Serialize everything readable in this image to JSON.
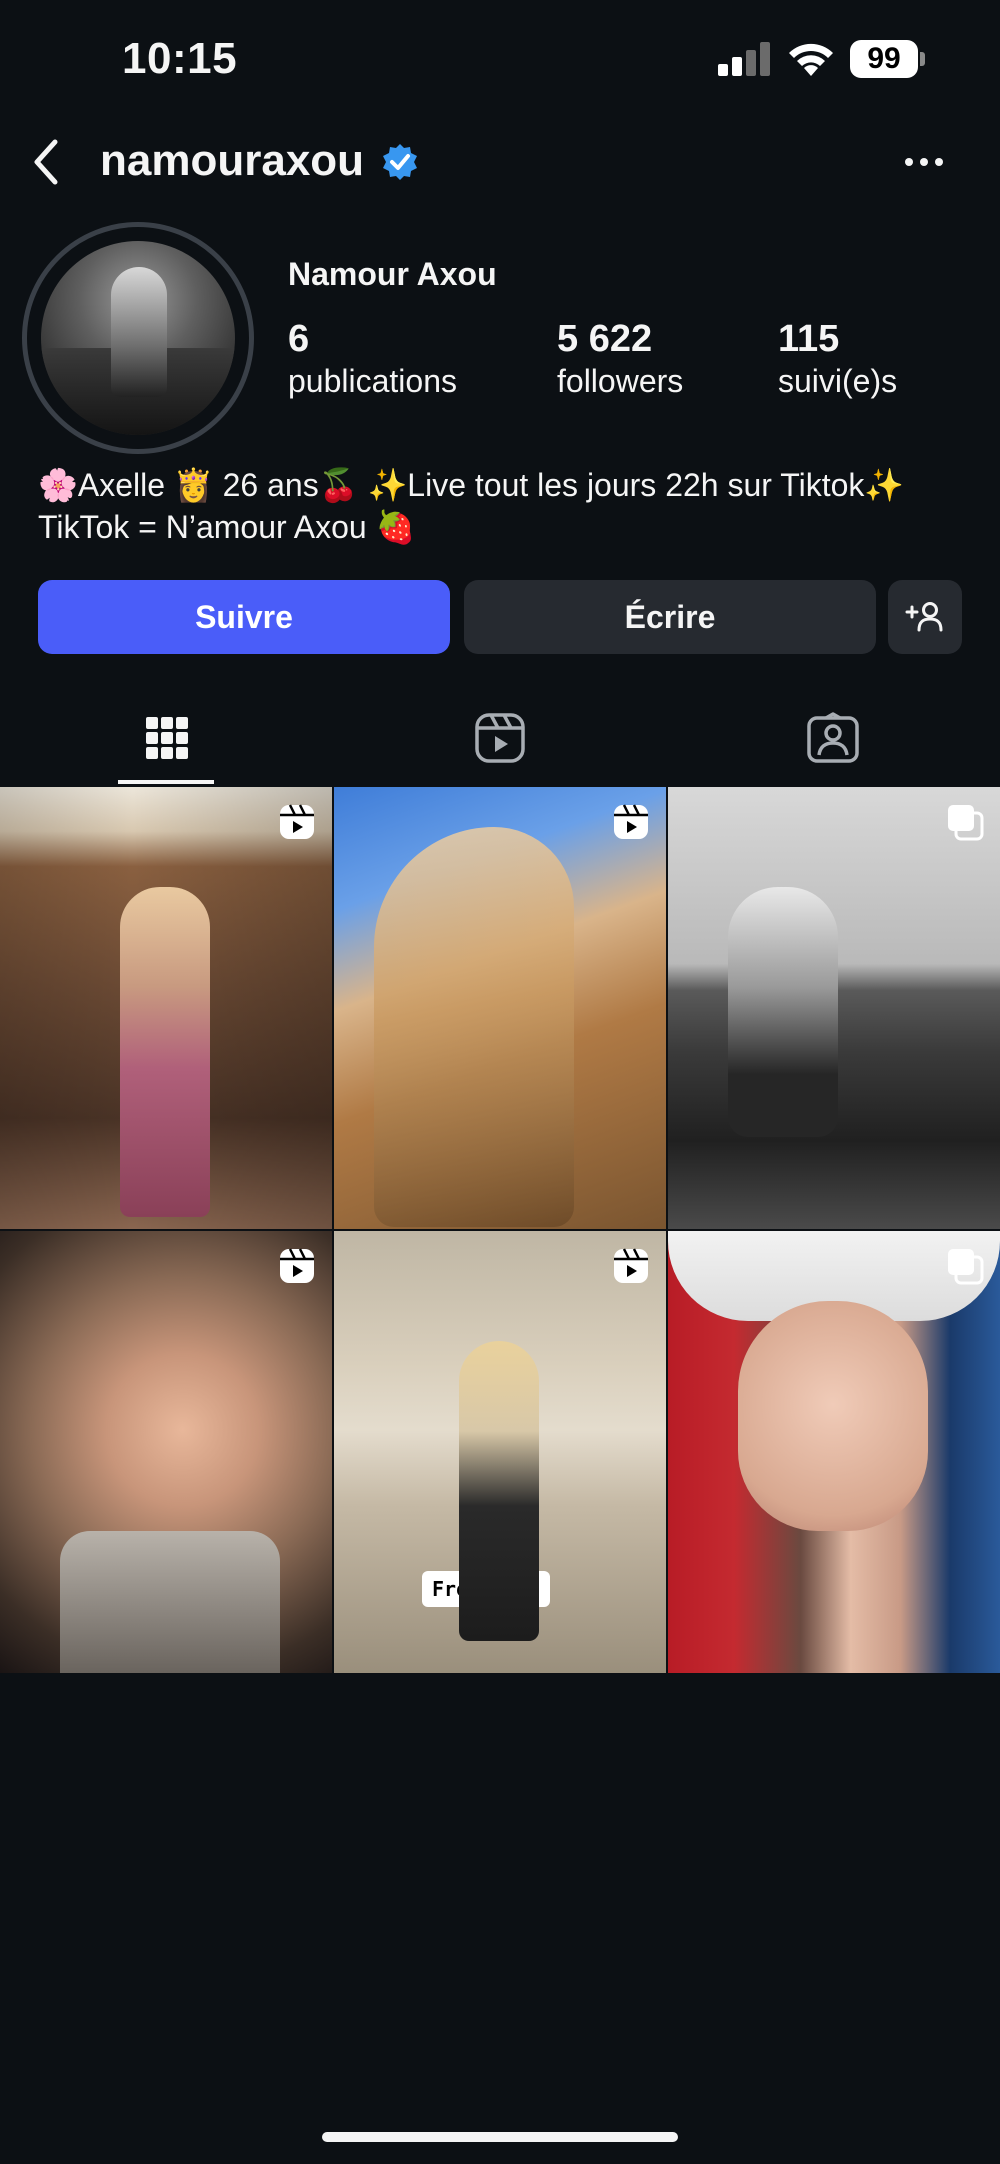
{
  "status_bar": {
    "time": "10:15",
    "battery": "99"
  },
  "header": {
    "username": "namouraxou",
    "verified_icon": "verified-badge-icon",
    "back_icon": "chevron-left-icon",
    "more_icon": "more-horizontal-icon"
  },
  "profile": {
    "display_name": "Namour Axou",
    "stats": [
      {
        "value": "6",
        "label": "publications"
      },
      {
        "value": "5 622",
        "label": "followers"
      },
      {
        "value": "115",
        "label": "suivi(e)s"
      }
    ],
    "bio_line1": "🌸Axelle 👸 26 ans🍒 ✨Live tout les jours 22h sur Tiktok✨",
    "bio_line2": "TikTok = N’amour Axou 🍓"
  },
  "actions": {
    "follow_label": "Suivre",
    "message_label": "Écrire",
    "suggest_icon": "add-person-icon"
  },
  "tabs": [
    {
      "name": "grid",
      "icon": "grid-icon",
      "active": true
    },
    {
      "name": "reels",
      "icon": "reels-icon",
      "active": false
    },
    {
      "name": "tagged",
      "icon": "tagged-person-icon",
      "active": false
    }
  ],
  "posts": [
    {
      "type": "reel",
      "badge_icon": "reel-badge-icon"
    },
    {
      "type": "reel",
      "badge_icon": "reel-badge-icon"
    },
    {
      "type": "carousel",
      "badge_icon": "carousel-badge-icon"
    },
    {
      "type": "reel",
      "badge_icon": "reel-badge-icon"
    },
    {
      "type": "reel",
      "badge_icon": "reel-badge-icon",
      "overlay_text": "Free Hugs"
    },
    {
      "type": "carousel",
      "badge_icon": "carousel-badge-icon"
    }
  ],
  "colors": {
    "background": "#0c1014",
    "follow_button": "#4a5df9",
    "secondary_button": "#262a30",
    "verified": "#3897f0"
  }
}
